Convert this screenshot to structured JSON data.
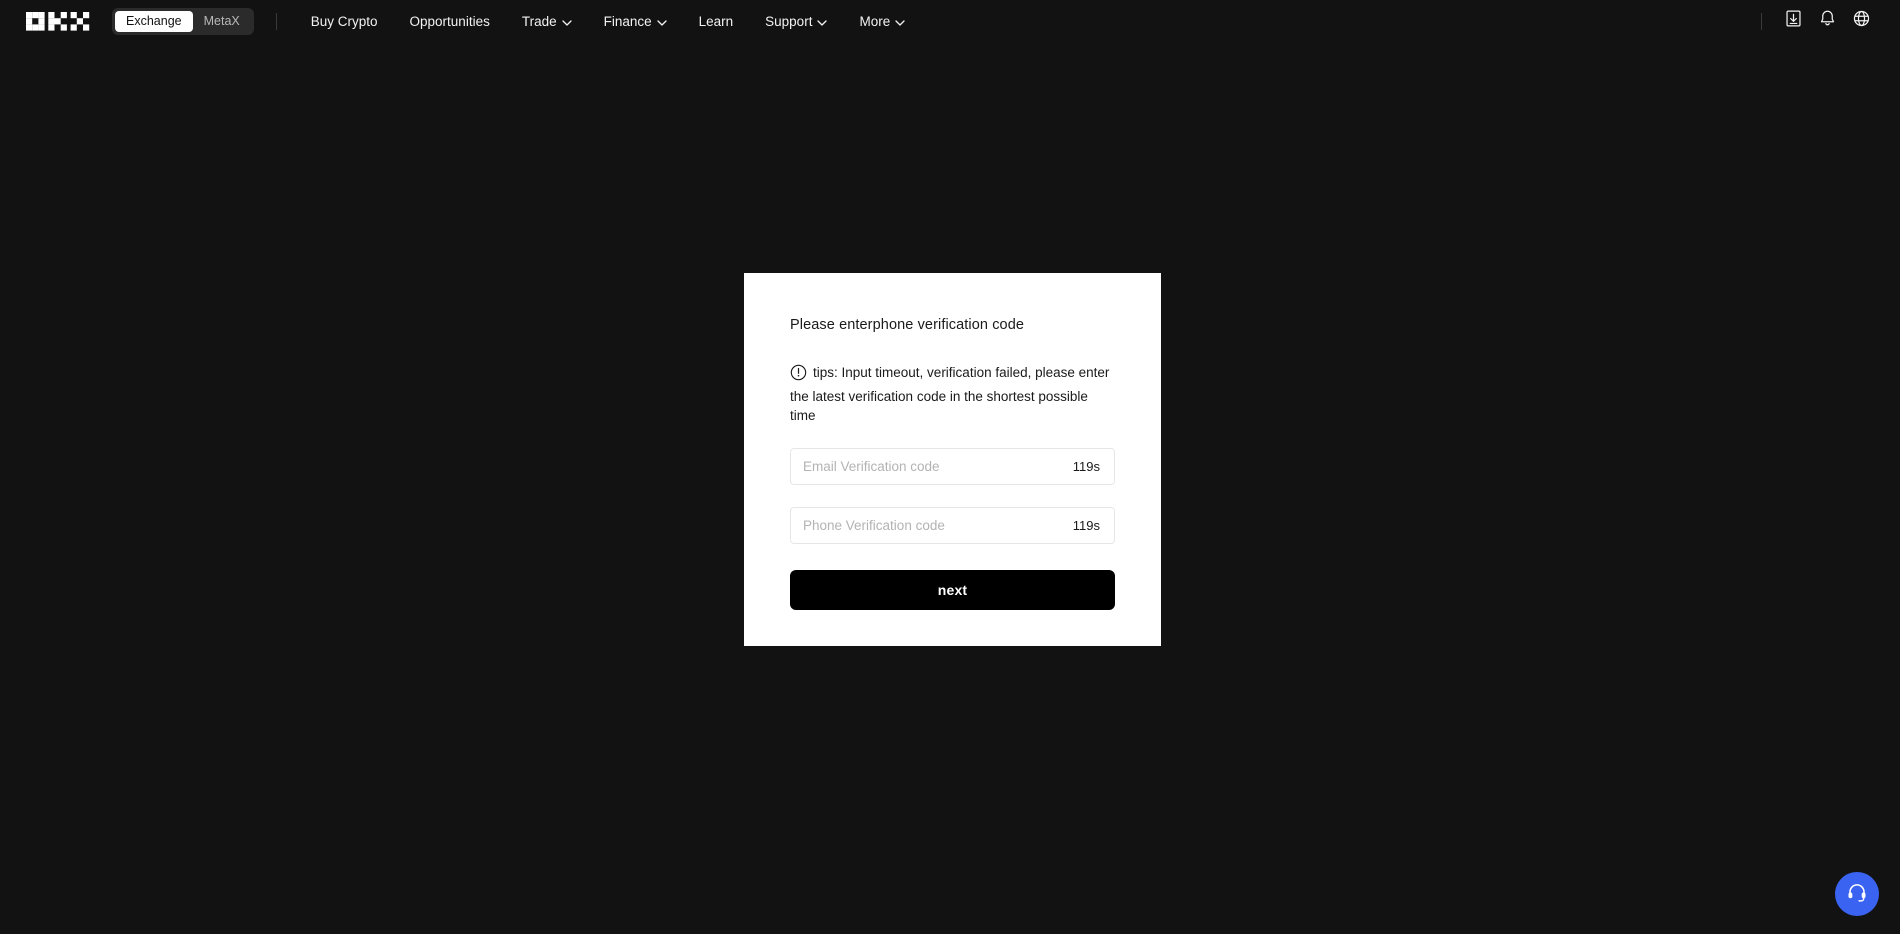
{
  "colors": {
    "page_bg": "#121212",
    "card_bg": "#ffffff",
    "accent_blue": "#3a63f2",
    "button_black": "#000000",
    "toggle_bg": "#2b2b2b"
  },
  "header": {
    "logo_name": "OKX",
    "toggle": {
      "items": [
        {
          "label": "Exchange",
          "active": true
        },
        {
          "label": "MetaX",
          "active": false
        }
      ]
    },
    "nav": [
      {
        "label": "Buy Crypto",
        "has_caret": false
      },
      {
        "label": "Opportunities",
        "has_caret": false
      },
      {
        "label": "Trade",
        "has_caret": true
      },
      {
        "label": "Finance",
        "has_caret": true
      },
      {
        "label": "Learn",
        "has_caret": false
      },
      {
        "label": "Support",
        "has_caret": true
      },
      {
        "label": "More",
        "has_caret": true
      }
    ],
    "actions": [
      {
        "icon": "download-icon"
      },
      {
        "icon": "bell-icon"
      },
      {
        "icon": "globe-icon"
      }
    ]
  },
  "card": {
    "title": "Please enterphone verification code",
    "tips_icon": "warning-circle-icon",
    "tips": "tips: Input timeout, verification failed, please enter the latest verification code in the shortest possible time",
    "fields": [
      {
        "name": "email-verification-code",
        "placeholder": "Email Verification code",
        "value": "",
        "timer": "119s"
      },
      {
        "name": "phone-verification-code",
        "placeholder": "Phone Verification code",
        "value": "",
        "timer": "119s"
      }
    ],
    "submit_label": "next"
  },
  "support": {
    "icon": "headset-icon"
  }
}
